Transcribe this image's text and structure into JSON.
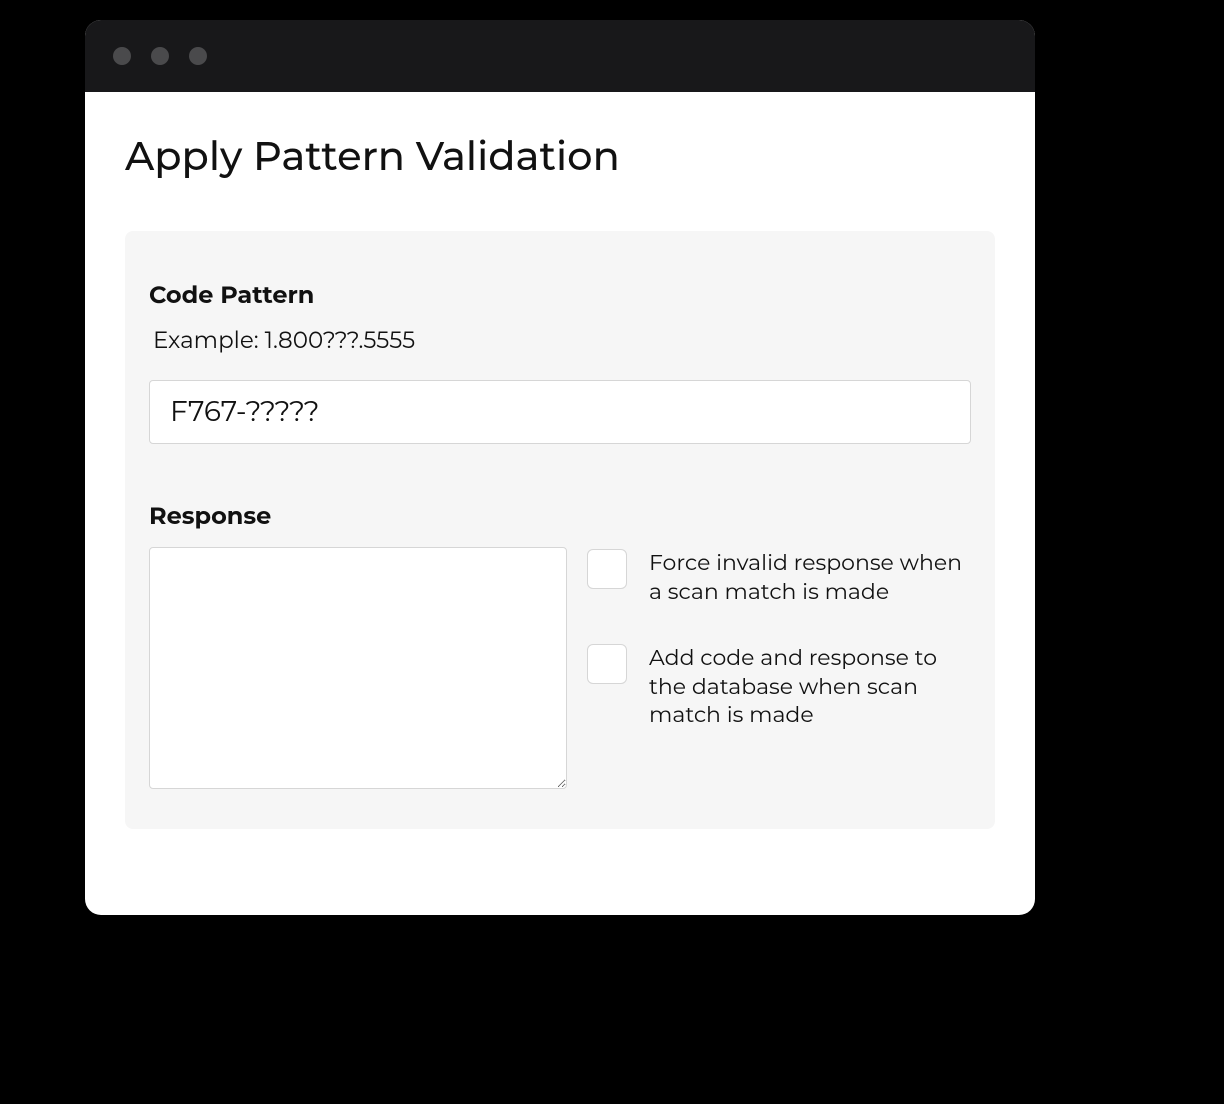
{
  "page": {
    "title": "Apply Pattern Validation"
  },
  "codePattern": {
    "heading": "Code Pattern",
    "example": "Example: 1.800???.5555",
    "value": "F767-?????"
  },
  "response": {
    "heading": "Response",
    "value": "",
    "checkboxes": [
      {
        "label": "Force invalid response when a scan match is made",
        "checked": false
      },
      {
        "label": "Add code and response to the database when scan match is made",
        "checked": false
      }
    ]
  }
}
